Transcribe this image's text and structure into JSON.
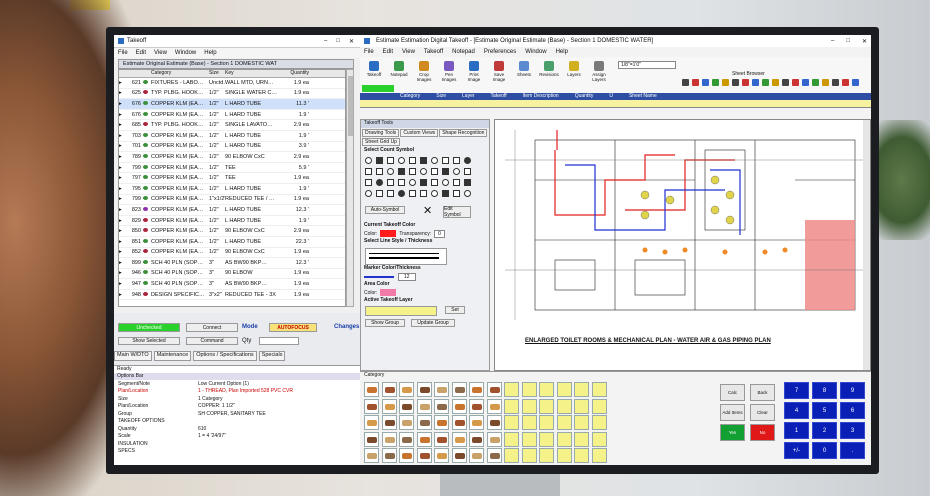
{
  "left_window": {
    "title": "Takeoff",
    "menu": [
      "File",
      "Edit",
      "View",
      "Window",
      "Help"
    ],
    "inner_title": "Estimate Original Estimate (Base) - Section 1 DOMESTIC WAT",
    "columns": [
      "",
      "",
      "Category",
      "Size",
      "Key",
      "Quantity"
    ],
    "rows": [
      {
        "n": "621",
        "cat": "FIXTURES - LABO…",
        "size": "Unctd…",
        "key": "WALL MTD, URN…",
        "qty": "1.9 ea",
        "color": "#3a8f3a"
      },
      {
        "n": "625",
        "cat": "TYP. PLBG. HOOK…",
        "size": "1/2\"",
        "key": "SINGLE WATER C…",
        "qty": "1.9 ea",
        "color": "#a8253a"
      },
      {
        "n": "676",
        "cat": "COPPER KLM (EA…",
        "size": "1/2\"",
        "key": "L HARD TUBE",
        "qty": "11.3 '",
        "color": "#3a8f3a"
      },
      {
        "n": "676",
        "cat": "COPPER KLM (EA…",
        "size": "1/2\"",
        "key": "L HARD TUBE",
        "qty": "1.9 '",
        "color": "#3a8f3a"
      },
      {
        "n": "685",
        "cat": "TYP. PLBG. HOOK…",
        "size": "1/2\"",
        "key": "SINGLE LAVATO…",
        "qty": "2.9 ea",
        "color": "#a8253a"
      },
      {
        "n": "703",
        "cat": "COPPER KLM (EA…",
        "size": "1/2\"",
        "key": "L HARD TUBE",
        "qty": "1.9 '",
        "color": "#3a8f3a"
      },
      {
        "n": "701",
        "cat": "COPPER KLM (EA…",
        "size": "1/2\"",
        "key": "L HARD TUBE",
        "qty": "3.9 '",
        "color": "#3a8f3a"
      },
      {
        "n": "789",
        "cat": "COPPER KLM (EA…",
        "size": "1/2\"",
        "key": "90 ELBOW CxC",
        "qty": "2.9 ea",
        "color": "#3a8f3a"
      },
      {
        "n": "799",
        "cat": "COPPER KLM (EA…",
        "size": "1/2\"",
        "key": "TEE",
        "qty": "5.9 '",
        "color": "#3a8f3a"
      },
      {
        "n": "797",
        "cat": "COPPER KLM (EA…",
        "size": "1/2\"",
        "key": "TEE",
        "qty": "1.9 ea",
        "color": "#3a8f3a"
      },
      {
        "n": "795",
        "cat": "COPPER KLM (EA…",
        "size": "1/2\"",
        "key": "L HARD TUBE",
        "qty": "1.9 '",
        "color": "#3a8f3a"
      },
      {
        "n": "799",
        "cat": "COPPER KLM (EA…",
        "size": "1\"x1/2\"",
        "key": "REDUCED TEE / …",
        "qty": "1.9 ea",
        "color": "#3a8f3a"
      },
      {
        "n": "823",
        "cat": "COPPER KLM (EA…",
        "size": "1/2\"",
        "key": "L HARD TUBE",
        "qty": "12.3 '",
        "color": "#8f2ea8"
      },
      {
        "n": "829",
        "cat": "COPPER KLM (EA…",
        "size": "1/2\"",
        "key": "L HARD TUBE",
        "qty": "1.9 '",
        "color": "#a8253a"
      },
      {
        "n": "850",
        "cat": "COPPER KLM (EA…",
        "size": "1/2\"",
        "key": "90 ELBOW CxC",
        "qty": "2.9 ea",
        "color": "#a8253a"
      },
      {
        "n": "851",
        "cat": "COPPER KLM (EA…",
        "size": "1/2\"",
        "key": "L HARD TUBE",
        "qty": "22.3 '",
        "color": "#3a8f3a"
      },
      {
        "n": "852",
        "cat": "COPPER KLM (EA…",
        "size": "1/2\"",
        "key": "90 ELBOW CxC",
        "qty": "1.9 ea",
        "color": "#a8253a"
      },
      {
        "n": "899",
        "cat": "SCH 40 PLN (SOP…",
        "size": "3\"",
        "key": "AS BW90 BKP…",
        "qty": "12.3 '",
        "color": "#3a8f3a"
      },
      {
        "n": "946",
        "cat": "SCH 40 PLN (SOP…",
        "size": "3\"",
        "key": "90 ELBOW",
        "qty": "1.9 ea",
        "color": "#3a8f3a"
      },
      {
        "n": "947",
        "cat": "SCH 40 PLN (SOP…",
        "size": "3\"",
        "key": "AS BW90 BKP…",
        "qty": "1.9 ea",
        "color": "#3a8f3a"
      },
      {
        "n": "948",
        "cat": "DESIGN SPECIFIC…",
        "size": "3\"x2\"",
        "key": "REDUCED TEE - 3X",
        "qty": "1.9 ea",
        "color": "#a8253a"
      }
    ]
  },
  "controls": {
    "green_button": "Unchecked",
    "connect": "Connect",
    "mode_label": "Mode",
    "autofocus": "AUTOFOCUS",
    "changes": "Changes",
    "show_selected": "Show Selected",
    "command": "Command",
    "qty_label": "Qty",
    "tabs": [
      "Main W/DTO",
      "Maintenance",
      "Options / Specifications",
      "Specials"
    ]
  },
  "options": {
    "status": "Ready",
    "title": "Options Bar",
    "rows": [
      [
        "Segment/Note",
        "Low Current Option (1)"
      ],
      [
        "Plan/Location",
        "1 - THREAD, Plan Imported 528 PVC CVR"
      ],
      [
        "Size",
        "1 Category"
      ],
      [
        "Plan/Location",
        "COPPER: 1 1/2\""
      ],
      [
        "Group",
        "SH COPPER, SANITARY TEE"
      ],
      [
        "TAKEOFF OPTIONS",
        ""
      ],
      [
        "Quantity",
        "610"
      ],
      [
        "Scale",
        "1 = 4 '24/97\""
      ],
      [
        "INSULATION",
        ""
      ],
      [
        "SPECS",
        ""
      ]
    ]
  },
  "main_window": {
    "title": "Estimate Estimation Digital Takeoff - [Estimate Original Estimate (Base) - Section 1 DOMESTIC WATER]",
    "menu": [
      "File",
      "Edit",
      "View",
      "Takeoff",
      "Notepad",
      "Preferences",
      "Window",
      "Help"
    ],
    "tools": [
      "Takeoff",
      "Notepad",
      "Crop Images",
      "Pen Images",
      "Print Image",
      "Save Image",
      "Sheets",
      "Revisions",
      "Layers",
      "Assign Layers"
    ],
    "scale_select": "1/8\"=1'0\"",
    "sheet_browser": "Sheet Browser",
    "header_cols": [
      "Category",
      "Size",
      "Layer",
      "Takeoff",
      "Item Description",
      "Quantity",
      "U",
      "Sheet Name"
    ],
    "drawing_caption": "ENLARGED TOILET ROOMS & MECHANICAL PLAN - WATER AIR & GAS PIPING PLAN"
  },
  "takeoff_tools": {
    "title": "Takeoff Tools",
    "tabs": [
      "Drawing Tools",
      "Custom Views",
      "Shape Recognition",
      "Street Grid Up"
    ],
    "select_count": "Select Count Symbol",
    "autosymbol": "Auto-Symbol",
    "edit_symbol": "Edit Symbol",
    "current_color": "Current Takeoff Color",
    "color_label": "Color:",
    "transparency_label": "Transparency:",
    "transparency_value": "0",
    "line_style": "Select Line Style / Thickness",
    "marker_color": "Marker Color/Thickness",
    "marker_value": "12",
    "area_color": "Area Color",
    "area_color_label": "Color:",
    "active_layer": "Active Takeoff Layer",
    "set_button": "Set",
    "show_group": "Show Group",
    "update_group": "Update Group"
  },
  "category": {
    "title": "Category",
    "fn_buttons": [
      "Calc",
      "Back",
      "Add Items",
      "Clear",
      "Yes",
      "No"
    ],
    "keypad": [
      "7",
      "8",
      "9",
      "4",
      "5",
      "6",
      "1",
      "2",
      "3",
      "+/-",
      "0",
      "."
    ]
  }
}
